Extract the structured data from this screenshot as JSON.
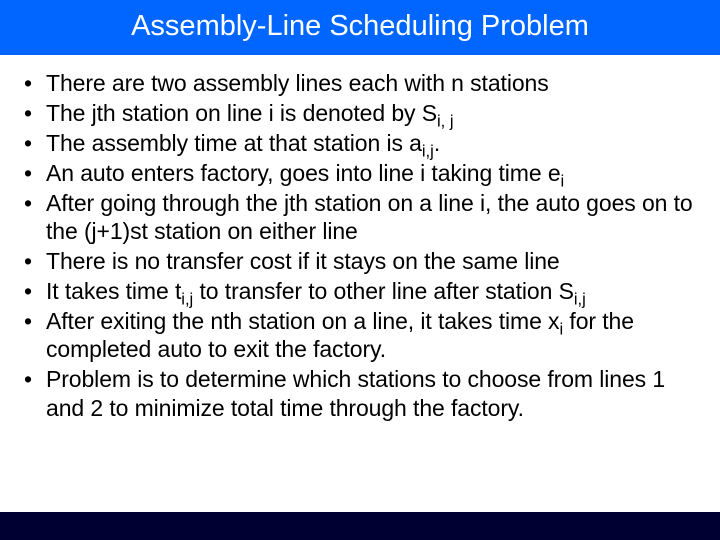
{
  "slide": {
    "title": "Assembly-Line Scheduling Problem",
    "bullets": [
      {
        "pre": "There are two assembly lines each with n stations",
        "sub": "",
        "post": ""
      },
      {
        "pre": "The jth station on line i is denoted by S",
        "sub": "i, j",
        "post": ""
      },
      {
        "pre": "The assembly time at that station is a",
        "sub": "i,j",
        "post": "."
      },
      {
        "pre": "An auto enters factory, goes into line i taking time e",
        "sub": "i",
        "post": ""
      },
      {
        "pre": "After going through the jth station on a line i, the auto goes on to the (j+1)st station on either line",
        "sub": "",
        "post": ""
      },
      {
        "pre": "There is no transfer cost if it stays on the same line",
        "sub": "",
        "post": ""
      },
      {
        "pre": "It takes time t",
        "sub": "i,j",
        "post": " to transfer to other line after station S",
        "sub2": "i,j",
        "post2": ""
      },
      {
        "pre": "After exiting the nth station on a line, it takes time x",
        "sub": "i",
        "post": " for the completed auto to exit the factory."
      },
      {
        "pre": "Problem is to determine which stations to choose from lines 1 and 2 to minimize total time through the factory.",
        "sub": "",
        "post": ""
      }
    ]
  }
}
